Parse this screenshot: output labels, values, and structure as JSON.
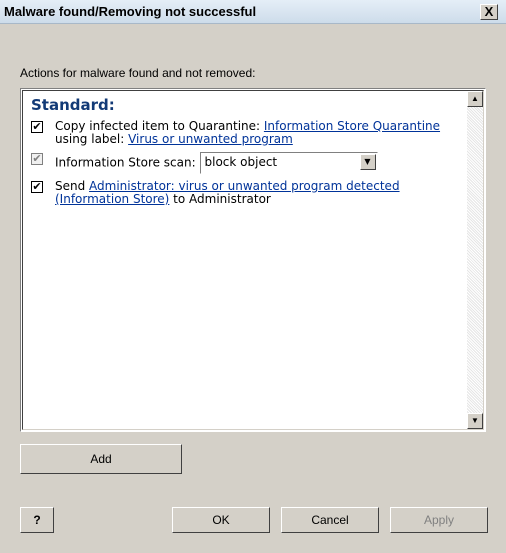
{
  "window": {
    "title": "Malware found/Removing not successful",
    "close_glyph": "X"
  },
  "section_label": "Actions for malware found and not removed:",
  "panel": {
    "heading": "Standard:",
    "items": {
      "copy": {
        "text_before": "Copy infected item to Quarantine: ",
        "link1": "Information Store Quarantine",
        "text_mid": "using label: ",
        "link2": "Virus or unwanted program",
        "checked": "✔"
      },
      "scan": {
        "label": "Information Store scan:",
        "select_value": "block object",
        "checked": "✔"
      },
      "send": {
        "text_before": "Send ",
        "link": "Administrator: virus or unwanted program detected (Information Store)",
        "text_after": " to Administrator",
        "checked": "✔"
      }
    },
    "scroll_up_glyph": "▲",
    "scroll_down_glyph": "▼"
  },
  "buttons": {
    "add": "Add",
    "ok": "OK",
    "cancel": "Cancel",
    "apply": "Apply",
    "help_glyph": "?"
  },
  "icons": {
    "checkbox": "checkbox-icon",
    "scroll_up": "arrow-up-icon",
    "scroll_down": "arrow-down-icon",
    "select_arrow": "chevron-down-icon",
    "help": "help-icon"
  }
}
